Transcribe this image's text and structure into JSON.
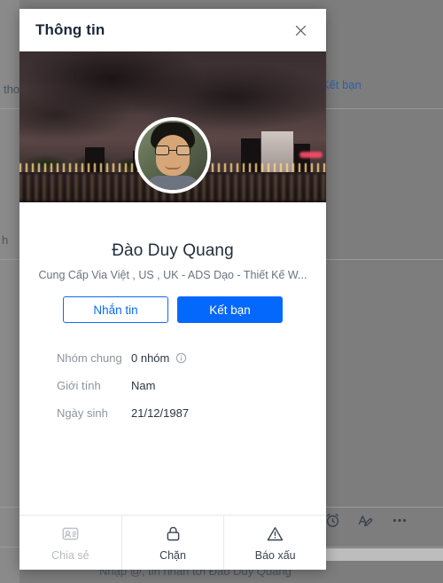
{
  "background": {
    "left_text_top": "tho",
    "left_text_bottom": "h",
    "add_friend_link": "Kết bạn",
    "compose_placeholder": "Nhập @, tin nhắn tới Đào Duy Quang",
    "toolbar": [
      {
        "name": "alarm-icon",
        "label": "alarm"
      },
      {
        "name": "text-format-icon",
        "label": "text format"
      },
      {
        "name": "more-options-icon",
        "label": "more"
      }
    ]
  },
  "dialog": {
    "title": "Thông tin",
    "close_label": "close-icon",
    "cover": {
      "name": "cover-photo",
      "alt": "night cityscape over river"
    },
    "avatar": {
      "name": "profile-avatar",
      "alt": "Đào Duy Quang"
    },
    "profile": {
      "name": "Đào Duy Quang",
      "bio": "Cung Cấp Via Việt , US , UK - ADS Dạo - Thiết Kế W..."
    },
    "actions": {
      "message_label": "Nhắn tin",
      "add_friend_label": "Kết bạn"
    },
    "info_rows": [
      {
        "label": "Nhóm chung",
        "value": "0 nhóm",
        "icon": "info-circle-icon"
      },
      {
        "label": "Giới tính",
        "value": "Nam",
        "icon": ""
      },
      {
        "label": "Ngày sinh",
        "value": "21/12/1987",
        "icon": ""
      }
    ],
    "footer": [
      {
        "label": "Chia sẻ",
        "icon": "contact-card-icon",
        "disabled": true
      },
      {
        "label": "Chặn",
        "icon": "lock-icon",
        "disabled": false
      },
      {
        "label": "Báo xấu",
        "icon": "warning-triangle-icon",
        "disabled": false
      }
    ]
  },
  "colors": {
    "primary_blue": "#0568fd",
    "outline_blue": "#0a6cfa",
    "title_text": "#1d2939",
    "muted_text": "#8d949e",
    "backdrop": "#7d7d7d"
  }
}
